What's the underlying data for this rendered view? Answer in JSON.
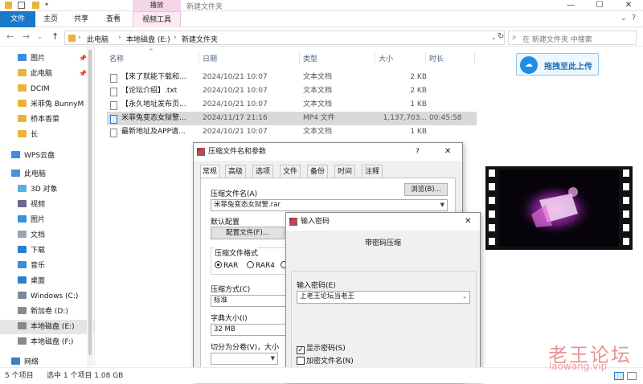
{
  "window": {
    "title": "新建文件夹",
    "context_tab": "播放"
  },
  "ribbon": {
    "tabs": [
      "文件",
      "主页",
      "共享",
      "查看",
      "视频工具"
    ]
  },
  "nav": {
    "path": [
      "此电脑",
      "本地磁盘 (E:)",
      "新建文件夹"
    ],
    "search_placeholder": "在 新建文件夹 中搜索"
  },
  "sidebar": {
    "items": [
      {
        "label": "图片",
        "color": "#3b8de0",
        "pinned": true
      },
      {
        "label": "此电脑",
        "color": "#e8b53a",
        "pinned": true
      },
      {
        "label": "DCIM",
        "color": "#e8b53a"
      },
      {
        "label": "米菲兔 BunnyM",
        "color": "#e8b53a"
      },
      {
        "label": "桥本香菜",
        "color": "#e8b53a"
      },
      {
        "label": "长",
        "color": "#e8b53a"
      },
      {
        "label": "WPS云盘",
        "color": "#3b8de0"
      },
      {
        "label": "此电脑",
        "color": "#4a90d9"
      },
      {
        "label": "3D 对象",
        "color": "#5ab0e8"
      },
      {
        "label": "视频",
        "color": "#6a6a8a"
      },
      {
        "label": "图片",
        "color": "#3b8de0"
      },
      {
        "label": "文档",
        "color": "#9aa6b8"
      },
      {
        "label": "下载",
        "color": "#2a7fd4"
      },
      {
        "label": "音乐",
        "color": "#3a8fd8"
      },
      {
        "label": "桌面",
        "color": "#2f7fd0"
      },
      {
        "label": "Windows (C:)",
        "color": "#7a8a9a"
      },
      {
        "label": "新加卷 (D:)",
        "color": "#8a8a8a"
      },
      {
        "label": "本地磁盘 (E:)",
        "color": "#8a8a8a"
      },
      {
        "label": "本地磁盘 (F:)",
        "color": "#8a8a8a"
      },
      {
        "label": "网络",
        "color": "#3b7fc8"
      }
    ]
  },
  "files": {
    "columns": [
      "名称",
      "日期",
      "类型",
      "大小",
      "时长"
    ],
    "rows": [
      {
        "name": "【来了就能下载和...",
        "date": "2024/10/21 10:07",
        "type": "文本文档",
        "size": "2 KB",
        "duration": ""
      },
      {
        "name": "【论坛介绍】.txt",
        "date": "2024/10/21 10:07",
        "type": "文本文档",
        "size": "2 KB",
        "duration": ""
      },
      {
        "name": "【永久地址发布页...",
        "date": "2024/10/21 10:07",
        "type": "文本文档",
        "size": "1 KB",
        "duration": ""
      },
      {
        "name": "米菲兔变态女狱警...",
        "date": "2024/11/17 21:16",
        "type": "MP4 文件",
        "size": "1,137,703...",
        "duration": "00:45:58"
      },
      {
        "name": "最新地址及APP请...",
        "date": "2024/10/21 10:07",
        "type": "文本文档",
        "size": "1 KB",
        "duration": ""
      }
    ]
  },
  "status": {
    "count": "5 个项目",
    "selected": "选中 1 个项目  1.08 GB"
  },
  "upload_button": {
    "label": "拖拽至此上传"
  },
  "archive_dialog": {
    "title": "压缩文件名和参数",
    "help": "?",
    "tabs": [
      "常规",
      "高级",
      "选项",
      "文件",
      "备份",
      "时间",
      "注释"
    ],
    "name_label": "压缩文件名(A)",
    "browse": "浏览(B)...",
    "name_value": "米菲兔变态女狱警.rar",
    "default_label": "默认配置",
    "profile_button": "配置文件(F)...",
    "format_label": "压缩文件格式",
    "formats": [
      "RAR",
      "RAR4",
      "Z"
    ],
    "method_label": "压缩方式(C)",
    "method_value": "标准",
    "dict_label": "字典大小(I)",
    "dict_value": "32 MB",
    "split_label": "切分为分卷(V)，大小"
  },
  "password_dialog": {
    "title": "输入密码",
    "heading": "带密码压缩",
    "input_label": "输入密码(E)",
    "input_value": "上老王论坛当老王",
    "show_password": "显示密码(S)",
    "encrypt_names": "加密文件名(N)"
  },
  "watermark": {
    "cn": "老王论坛",
    "en": "laowang.vip"
  }
}
